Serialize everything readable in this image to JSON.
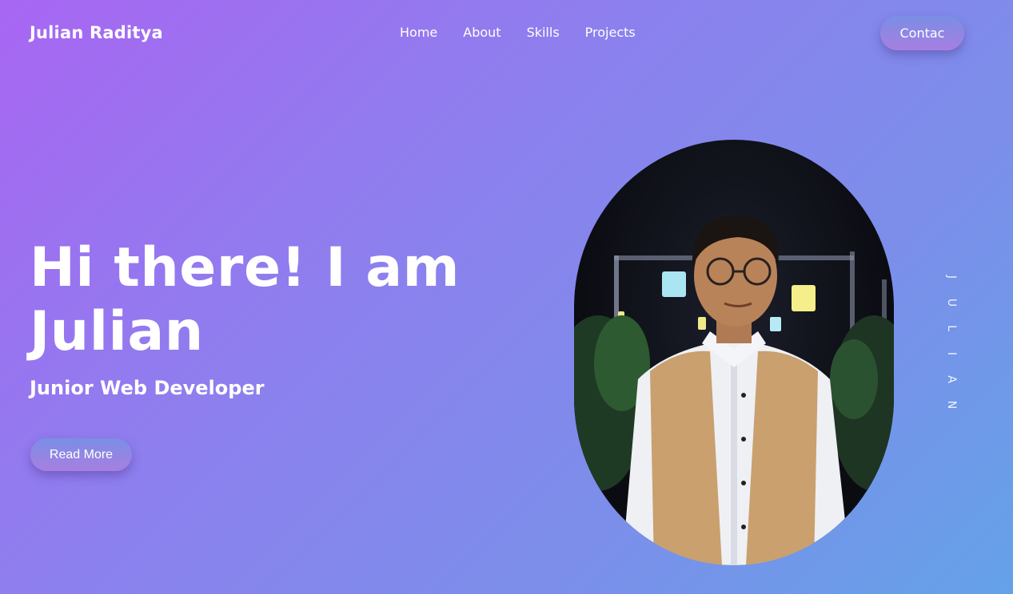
{
  "header": {
    "brand": "Julian Raditya",
    "nav": [
      "Home",
      "About",
      "Skills",
      "Projects"
    ],
    "contact_label": "Contac"
  },
  "hero": {
    "title": "Hi there! I am Julian",
    "subtitle": "Junior Web Developer",
    "read_more_label": "Read More"
  },
  "side_name": [
    "J",
    "U",
    "L",
    "I",
    "A",
    "N"
  ],
  "colors": {
    "gradient_start": "#a866f2",
    "gradient_end": "#64a2e8",
    "button_top": "#7a8ee6",
    "button_bottom": "#a77fe0"
  }
}
